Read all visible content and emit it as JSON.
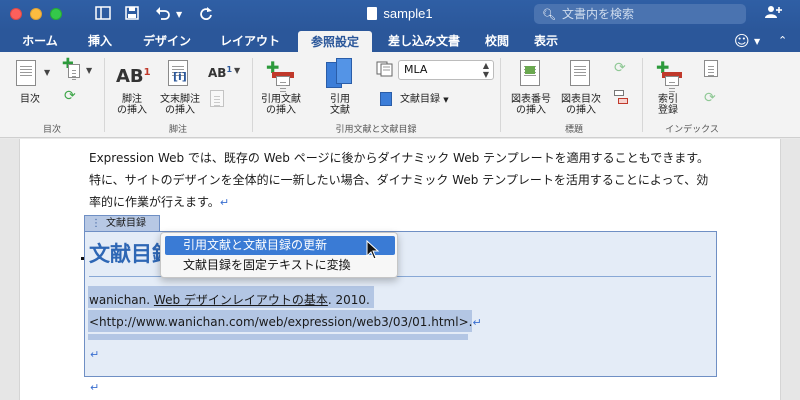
{
  "window": {
    "title": "sample1",
    "search_placeholder": "文書内を検索"
  },
  "tabs": [
    {
      "label": "ホーム"
    },
    {
      "label": "挿入"
    },
    {
      "label": "デザイン"
    },
    {
      "label": "レイアウト"
    },
    {
      "label": "参照設定",
      "active": true
    },
    {
      "label": "差し込み文書"
    },
    {
      "label": "校閲"
    },
    {
      "label": "表示"
    }
  ],
  "ribbon": {
    "toc": {
      "label": "目次",
      "group": "目次"
    },
    "footnote": {
      "insert_footnote": "脚注\nの挿入",
      "insert_endnote": "文末脚注\nの挿入",
      "group": "脚注"
    },
    "citations": {
      "insert_citation": "引用文献\nの挿入",
      "citation": "引用\n文献",
      "style_value": "MLA",
      "bibliography": "文献目録",
      "group": "引用文献と文献目録"
    },
    "captions": {
      "insert_caption": "図表番号\nの挿入",
      "insert_table_of_figures": "図表目次\nの挿入",
      "group": "標題"
    },
    "index": {
      "mark_entry": "索引\n登録",
      "group": "インデックス"
    }
  },
  "document": {
    "paragraph_lines": [
      "Expression Web では、既存の Web ページに後からダイナミック Web テンプレートを適用することもできます。",
      "特に、サイトのデザインを全体的に一新したい場合、ダイナミック Web テンプレートを活用することによって、効",
      "率的に作業が行えます。"
    ],
    "bibliography_tag": "文献目録",
    "bibliography_heading": "文献目録",
    "entry_author": "wanichan. ",
    "entry_title": "Web デザインレイアウトの基本",
    "entry_year": ". 2010.",
    "entry_url": "<http://www.wanichan.com/web/expression/web3/03/01.html>."
  },
  "context_menu": {
    "items": [
      {
        "label": "引用文献と文献目録の更新",
        "selected": true
      },
      {
        "label": "文献目録を固定テキストに変換",
        "selected": false
      }
    ]
  },
  "colors": {
    "titlebar": "#2b579a",
    "heading": "#2e67b5",
    "menu_highlight": "#3a7bd5",
    "selection": "#b3c6e4"
  }
}
